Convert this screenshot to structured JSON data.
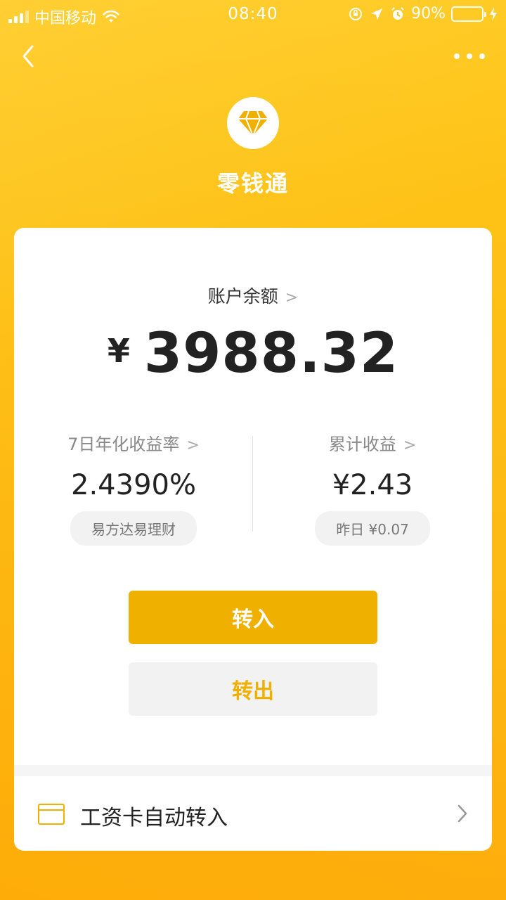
{
  "status_bar": {
    "carrier": "中国移动",
    "time": "08:40",
    "battery_percent": "90%",
    "battery_level": 0.9
  },
  "nav": {
    "back_icon": "chevron-left-icon",
    "more_icon": "more-dots-icon"
  },
  "app": {
    "title": "零钱通",
    "logo_icon": "diamond-icon"
  },
  "balance": {
    "label": "账户余额",
    "currency": "¥",
    "amount": "3988.32"
  },
  "stats": {
    "rate_label": "7日年化收益率",
    "rate_value": "2.4390%",
    "rate_provider": "易方达易理财",
    "earnings_label": "累计收益",
    "earnings_value": "¥2.43",
    "yesterday": "昨日 ¥0.07"
  },
  "actions": {
    "transfer_in": "转入",
    "transfer_out": "转出"
  },
  "auto_transfer": {
    "label": "工资卡自动转入"
  },
  "colors": {
    "background": "#FDBB18",
    "accent": "#F0B000",
    "battery": "#4CD964"
  }
}
